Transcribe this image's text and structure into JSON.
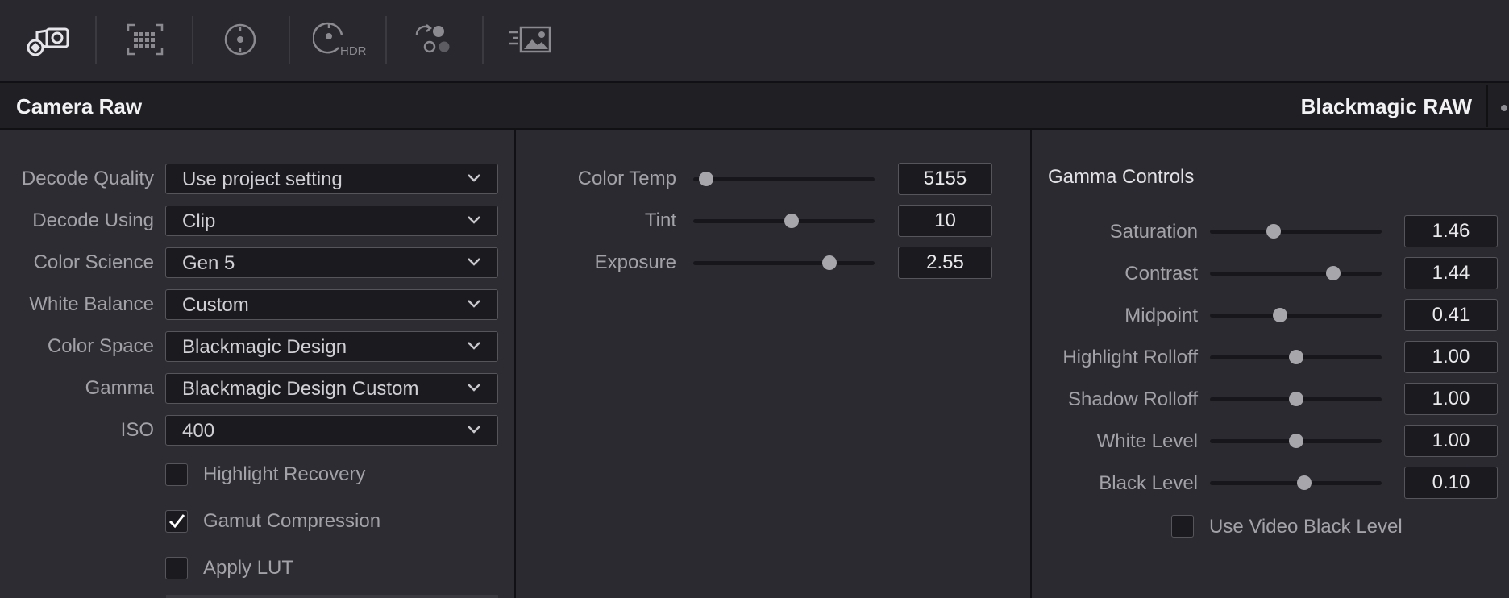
{
  "toolbar": {
    "icons": [
      "camera-raw-icon",
      "color-chart-icon",
      "color-wheel-icon",
      "hdr-wheel-icon",
      "rgb-mixer-icon",
      "motion-effects-icon"
    ],
    "hdr_label": "HDR"
  },
  "header": {
    "title": "Camera Raw",
    "raw_format": "Blackmagic RAW"
  },
  "decode": [
    {
      "label": "Decode Quality",
      "value": "Use project setting"
    },
    {
      "label": "Decode Using",
      "value": "Clip"
    },
    {
      "label": "Color Science",
      "value": "Gen 5"
    },
    {
      "label": "White Balance",
      "value": "Custom"
    },
    {
      "label": "Color Space",
      "value": "Blackmagic Design"
    },
    {
      "label": "Gamma",
      "value": "Blackmagic Design Custom"
    },
    {
      "label": "ISO",
      "value": "400"
    }
  ],
  "options": [
    {
      "label": "Highlight Recovery",
      "checked": false
    },
    {
      "label": "Gamut Compression",
      "checked": true
    },
    {
      "label": "Apply LUT",
      "checked": false
    }
  ],
  "color": [
    {
      "label": "Color Temp",
      "value": "5155",
      "level": 0.07
    },
    {
      "label": "Tint",
      "value": "10",
      "level": 0.54
    },
    {
      "label": "Exposure",
      "value": "2.55",
      "level": 0.75
    }
  ],
  "gamma_controls": {
    "title": "Gamma Controls",
    "sliders": [
      {
        "label": "Saturation",
        "value": "1.46",
        "level": 0.37
      },
      {
        "label": "Contrast",
        "value": "1.44",
        "level": 0.72
      },
      {
        "label": "Midpoint",
        "value": "0.41",
        "level": 0.41
      },
      {
        "label": "Highlight Rolloff",
        "value": "1.00",
        "level": 0.5
      },
      {
        "label": "Shadow Rolloff",
        "value": "1.00",
        "level": 0.5
      },
      {
        "label": "White Level",
        "value": "1.00",
        "level": 0.5
      },
      {
        "label": "Black Level",
        "value": "0.10",
        "level": 0.55
      }
    ],
    "video_black_level": {
      "label": "Use Video Black Level",
      "checked": false
    }
  }
}
